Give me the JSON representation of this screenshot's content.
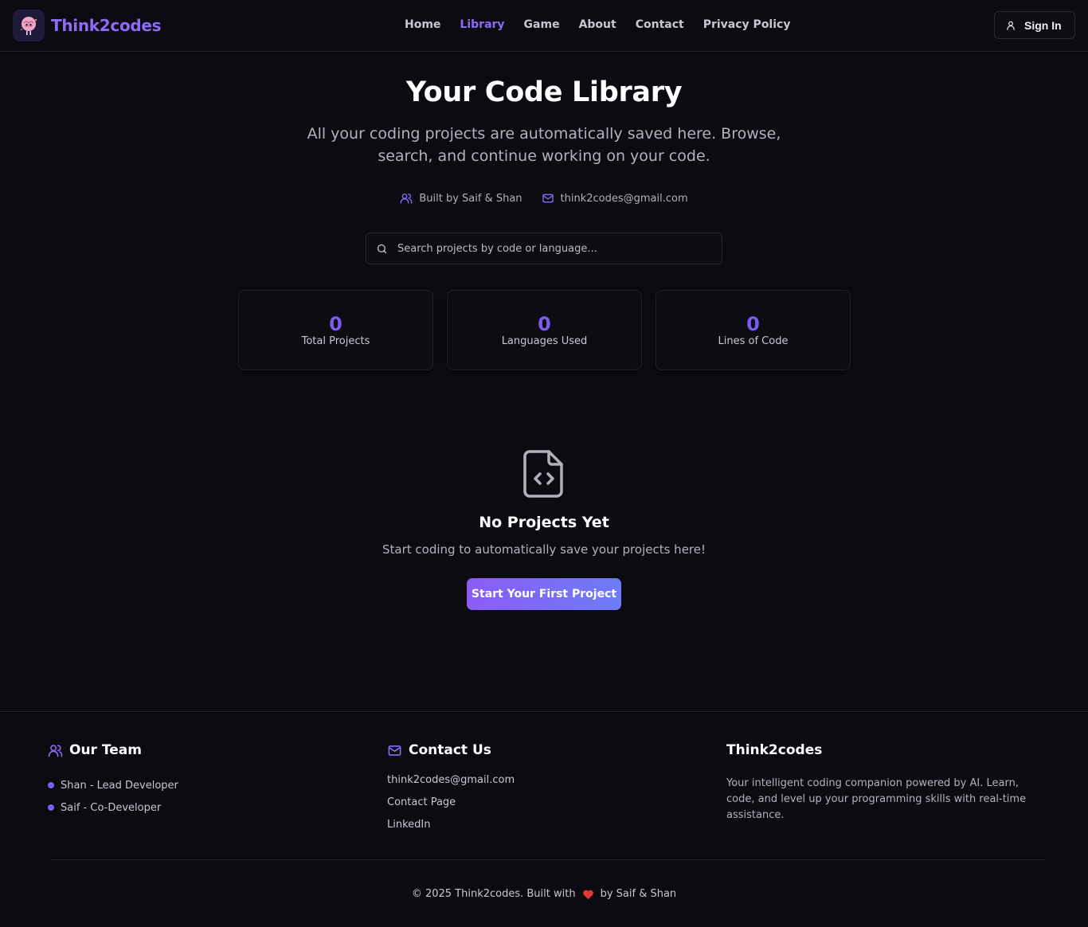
{
  "nav": {
    "brand": "Think2codes",
    "links": [
      {
        "label": "Home",
        "active": false
      },
      {
        "label": "Library",
        "active": true
      },
      {
        "label": "Game",
        "active": false
      },
      {
        "label": "About",
        "active": false
      },
      {
        "label": "Contact",
        "active": false
      },
      {
        "label": "Privacy Policy",
        "active": false
      }
    ],
    "signin_label": "Sign In"
  },
  "hero": {
    "title": "Your Code Library",
    "subtitle": "All your coding projects are automatically saved here. Browse, search, and continue working on your code.",
    "built_by": "Built by Saif & Shan",
    "email": "think2codes@gmail.com"
  },
  "search": {
    "placeholder": "Search projects by code or language..."
  },
  "stats": [
    {
      "value": "0",
      "label": "Total Projects"
    },
    {
      "value": "0",
      "label": "Languages Used"
    },
    {
      "value": "0",
      "label": "Lines of Code"
    }
  ],
  "empty": {
    "icon": "file-code-icon",
    "title": "No Projects Yet",
    "subtitle": "Start coding to automatically save your projects here!",
    "cta_label": "Start Your First Project"
  },
  "footer": {
    "team_heading": "Our Team",
    "team": [
      "Shan - Lead Developer",
      "Saif - Co-Developer"
    ],
    "contact_heading": "Contact Us",
    "contact_links": [
      "think2codes@gmail.com",
      "Contact Page",
      "LinkedIn"
    ],
    "about_heading": "Think2codes",
    "about_text": "Your intelligent coding companion powered by AI. Learn, code, and level up your programming skills with real-time assistance.",
    "copyright_prefix": "© 2025 Think2codes. Built with",
    "copyright_suffix": "by Saif & Shan"
  },
  "colors": {
    "accent": "#8b6cf6",
    "background": "#0d0b12",
    "heart": "#e53935"
  }
}
